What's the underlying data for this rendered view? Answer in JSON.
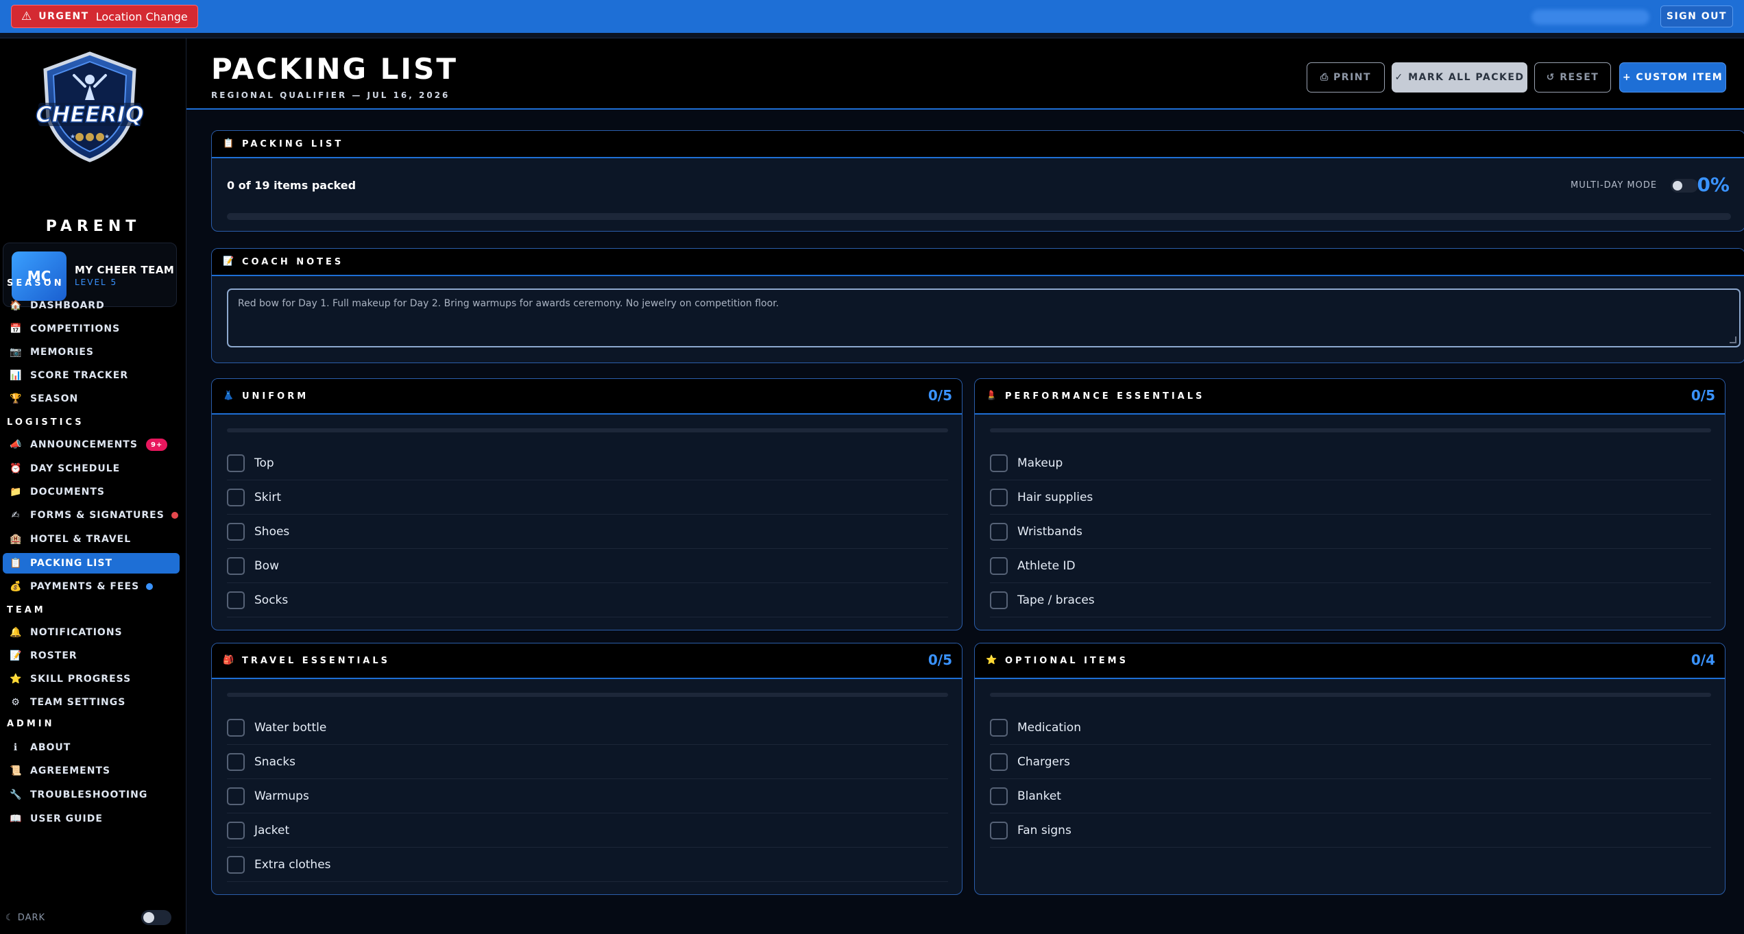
{
  "topbar": {
    "urgent_tag": "URGENT",
    "urgent_message": "Location Change",
    "signout_label": "SIGN OUT"
  },
  "sidebar": {
    "logo_text": "CHEERIQ",
    "role": "PARENT",
    "team": {
      "initials": "MC",
      "name": "MY CHEER TEAM",
      "level": "LEVEL 5"
    },
    "sections": [
      {
        "title": "SEASON",
        "items": [
          {
            "label": "DASHBOARD",
            "icon": "house-icon"
          },
          {
            "label": "COMPETITIONS",
            "icon": "calendar-icon"
          },
          {
            "label": "MEMORIES",
            "icon": "camera-icon"
          },
          {
            "label": "SCORE TRACKER",
            "icon": "bar-chart-icon"
          },
          {
            "label": "SEASON",
            "icon": "trophy-icon"
          }
        ]
      },
      {
        "title": "LOGISTICS",
        "items": [
          {
            "label": "ANNOUNCEMENTS",
            "icon": "megaphone-icon",
            "badge": "9+"
          },
          {
            "label": "DAY SCHEDULE",
            "icon": "alarm-clock-icon"
          },
          {
            "label": "DOCUMENTS",
            "icon": "folder-icon"
          },
          {
            "label": "FORMS & SIGNATURES",
            "icon": "writing-hand-icon",
            "dot": "#e5484d"
          },
          {
            "label": "HOTEL & TRAVEL",
            "icon": "hotel-icon"
          },
          {
            "label": "PACKING LIST",
            "icon": "clipboard-icon",
            "active": true
          },
          {
            "label": "PAYMENTS & FEES",
            "icon": "money-bag-icon",
            "dot": "#3a93ff"
          }
        ]
      },
      {
        "title": "TEAM",
        "items": [
          {
            "label": "NOTIFICATIONS",
            "icon": "bell-icon"
          },
          {
            "label": "ROSTER",
            "icon": "notepad-icon"
          },
          {
            "label": "SKILL PROGRESS",
            "icon": "star-icon"
          },
          {
            "label": "TEAM SETTINGS",
            "icon": "gear-icon"
          }
        ]
      },
      {
        "title": "ADMIN",
        "items": [
          {
            "label": "ABOUT",
            "icon": "info-icon"
          },
          {
            "label": "AGREEMENTS",
            "icon": "scroll-icon"
          },
          {
            "label": "TROUBLESHOOTING",
            "icon": "wrench-icon"
          },
          {
            "label": "USER GUIDE",
            "icon": "book-icon"
          }
        ]
      }
    ],
    "dark_label": "DARK"
  },
  "header": {
    "title": "PACKING LIST",
    "subtitle": "REGIONAL QUALIFIER — JUL 16, 2026",
    "buttons": {
      "print": "⎙ PRINT",
      "mark_all": "✓ MARK ALL PACKED",
      "reset": "↺ RESET",
      "custom": "+ CUSTOM ITEM"
    }
  },
  "progress": {
    "title": "PACKING LIST",
    "status": "0 of 19 items packed",
    "multiday_label": "MULTI-DAY MODE",
    "percent_label": "0%",
    "fraction": 0
  },
  "notes": {
    "title": "COACH NOTES",
    "text": "Red bow for Day 1. Full makeup for Day 2. Bring warmups for awards ceremony. No jewelry on competition floor."
  },
  "categories": [
    {
      "title": "UNIFORM",
      "icon": "dress-icon",
      "count": "0/5",
      "items": [
        "Top",
        "Skirt",
        "Shoes",
        "Bow",
        "Socks"
      ]
    },
    {
      "title": "PERFORMANCE ESSENTIALS",
      "icon": "lipstick-icon",
      "count": "0/5",
      "items": [
        "Makeup",
        "Hair supplies",
        "Wristbands",
        "Athlete ID",
        "Tape / braces"
      ]
    },
    {
      "title": "TRAVEL ESSENTIALS",
      "icon": "backpack-icon",
      "count": "0/5",
      "items": [
        "Water bottle",
        "Snacks",
        "Warmups",
        "Jacket",
        "Extra clothes"
      ]
    },
    {
      "title": "OPTIONAL ITEMS",
      "icon": "star-icon",
      "count": "0/4",
      "items": [
        "Medication",
        "Chargers",
        "Blanket",
        "Fan signs"
      ]
    }
  ]
}
